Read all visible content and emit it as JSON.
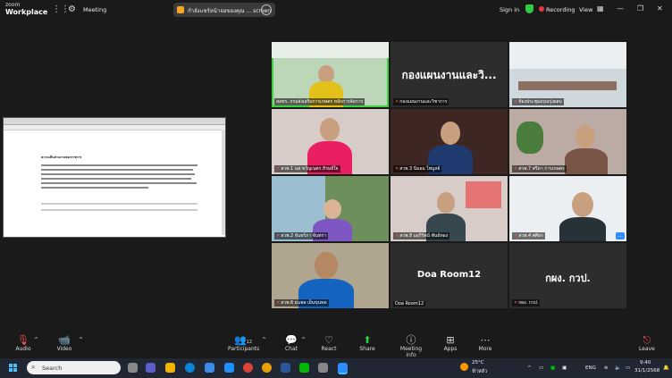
{
  "app": {
    "logo_top": "zoom",
    "logo_bottom": "Workplace",
    "meeting_label": "Meeting"
  },
  "share": {
    "text": "กำลังแชร์หน้าจอของคุณ ... screen"
  },
  "header": {
    "signin": "Sign in",
    "recording": "Recording",
    "view": "View"
  },
  "document": {
    "heading": "ความเห็นส่วนงานของราชการ"
  },
  "tiles": [
    {
      "label": "สลขร. กรมส่งเสริมการเกษตร หลักการจัดการ",
      "mic_muted": false
    },
    {
      "label": "กองแผนงานและวิชาการ",
      "big": "กองแผนงานและวิ...",
      "mic_muted": true
    },
    {
      "label": "ห้องประชุมอรุณรุ่งผสม",
      "mic_muted": true
    },
    {
      "label": "สวพ.1 นส.ขวัญเนตร ภิรมย์ใจ",
      "mic_muted": true
    },
    {
      "label": "สวพ.3 นิ่มอม ไพบูลย์",
      "mic_muted": true
    },
    {
      "label": "สวพ.7 ศรีดา การเกษตร",
      "mic_muted": true
    },
    {
      "label": "สวพ.2 จันทร์ภา จันทรา",
      "mic_muted": true
    },
    {
      "label": "สวพ.8 มยุรีรัตน์ พันธ์ทอง",
      "mic_muted": true
    },
    {
      "label": "สวพ.4 ศศิธร",
      "mic_muted": true
    },
    {
      "label": "สวพ.6 ธนพล เย็นขุนทด",
      "mic_muted": true
    },
    {
      "label": "Doa Room12",
      "big": "Doa Room12",
      "mic_muted": false
    },
    {
      "label": "กผง. กวป.",
      "big": "กผง. กวป.",
      "mic_muted": true
    }
  ],
  "toolbar": {
    "audio": "Audio",
    "video": "Video",
    "participants": "Participants",
    "participants_count": "12",
    "chat": "Chat",
    "react": "React",
    "share": "Share",
    "meeting_info": "Meeting info",
    "apps": "Apps",
    "more": "More",
    "leave": "Leave"
  },
  "taskbar": {
    "search": "Search",
    "weather_temp": "25°C",
    "weather_desc": "ฟ้าหลัว",
    "lang": "ENG",
    "time": "9:40",
    "date": "31/1/2568"
  }
}
